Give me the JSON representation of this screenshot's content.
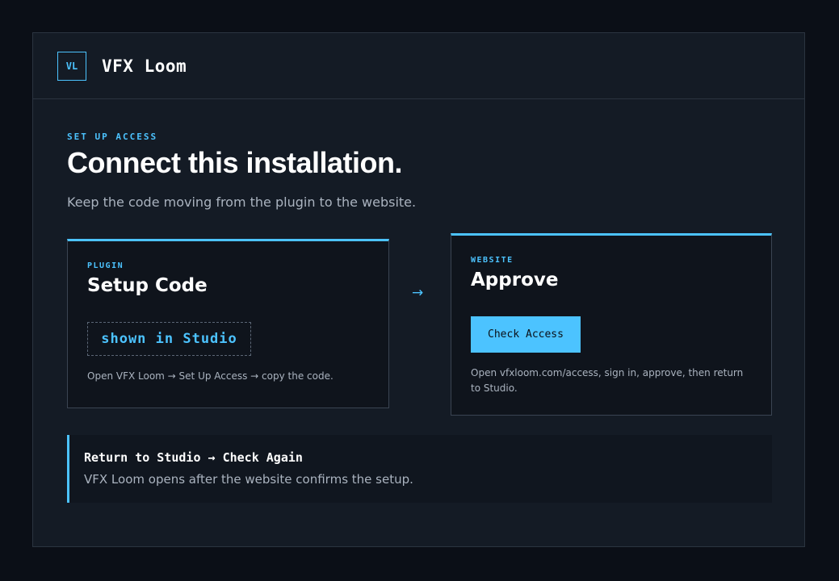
{
  "header": {
    "logo_text": "VL",
    "app_title": "VFX Loom"
  },
  "hero": {
    "eyebrow": "SET UP ACCESS",
    "headline": "Connect this installation.",
    "subtitle": "Keep the code moving from the plugin to the website."
  },
  "cards": {
    "plugin": {
      "label": "PLUGIN",
      "title": "Setup Code",
      "code": "shown in Studio",
      "note": "Open VFX Loom → Set Up Access → copy the code."
    },
    "arrow": "→",
    "website": {
      "label": "WEBSITE",
      "title": "Approve",
      "button_label": "Check Access",
      "note": "Open vfxloom.com/access, sign in, approve, then return to Studio."
    }
  },
  "callout": {
    "title": "Return to Studio → Check Again",
    "text": "VFX Loom opens after the website confirms the setup."
  },
  "colors": {
    "background": "#0b0f17",
    "panel": "#141b25",
    "accent": "#4cc3ff",
    "text": "#ffffff",
    "muted_text": "#aab3bf"
  }
}
